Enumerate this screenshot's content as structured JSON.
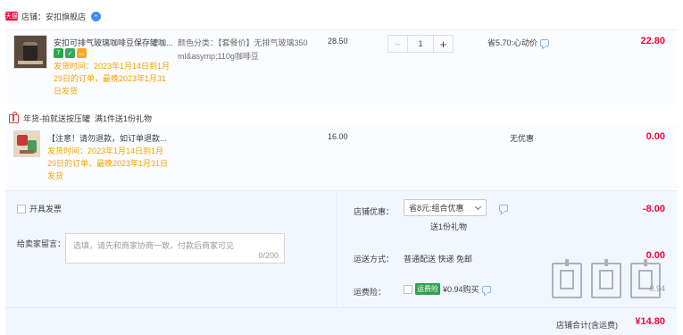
{
  "shop": {
    "badge": "天猫",
    "name": "店铺：安扣旗舰店",
    "chat_icon": "chat-bubble-icon"
  },
  "main_item": {
    "title": "安扣可排气玻璃咖啡豆保存罐咖...",
    "badges": [
      "7",
      "shield",
      "card"
    ],
    "ship_note": "发货时间：2023年1月14日到1月29日的订单，最晚2023年1月31日发货",
    "spec": "颜色分类：【套餐价】无排气玻璃350ml&asymp;110g咖啡豆",
    "unit_price": "28.50",
    "quantity": "1",
    "minus_label": "−",
    "plus_label": "+",
    "discount": "省5.70:心动价",
    "subtotal": "22.80"
  },
  "gift_header": {
    "label": "年货-拍就送按压罐",
    "rule": "满1件送1份礼物"
  },
  "gift_item": {
    "title": "【注意！请勿退款，如订单退款...",
    "ship_note": "发货时间：2023年1月14日到1月29日的订单，最晚2023年1月31日发货",
    "unit_price": "16.00",
    "discount": "无优惠",
    "subtotal": "0.00"
  },
  "invoice": {
    "label": "开具发票"
  },
  "message": {
    "label": "给卖家留言：",
    "placeholder": "选填，请先和商家协商一致，付款后商家可见",
    "count": "0/200"
  },
  "shop_discount": {
    "label": "店铺优惠：",
    "selected": "省8元:组合优惠",
    "sub": "送1份礼物",
    "amount": "-8.00"
  },
  "shipping": {
    "label": "运送方式：",
    "method": "普通配送 快递 免邮",
    "amount": "0.00"
  },
  "insurance": {
    "label": "运费险：",
    "tag": "运费险",
    "price": "¥0.94购买",
    "amount": "0.94"
  },
  "total": {
    "label": "店铺合计(含运费)",
    "amount": "¥14.80"
  },
  "colors": {
    "price_red": "#ff0036",
    "note_orange": "#f5a300",
    "panel_blue": "#f2f7ff"
  }
}
